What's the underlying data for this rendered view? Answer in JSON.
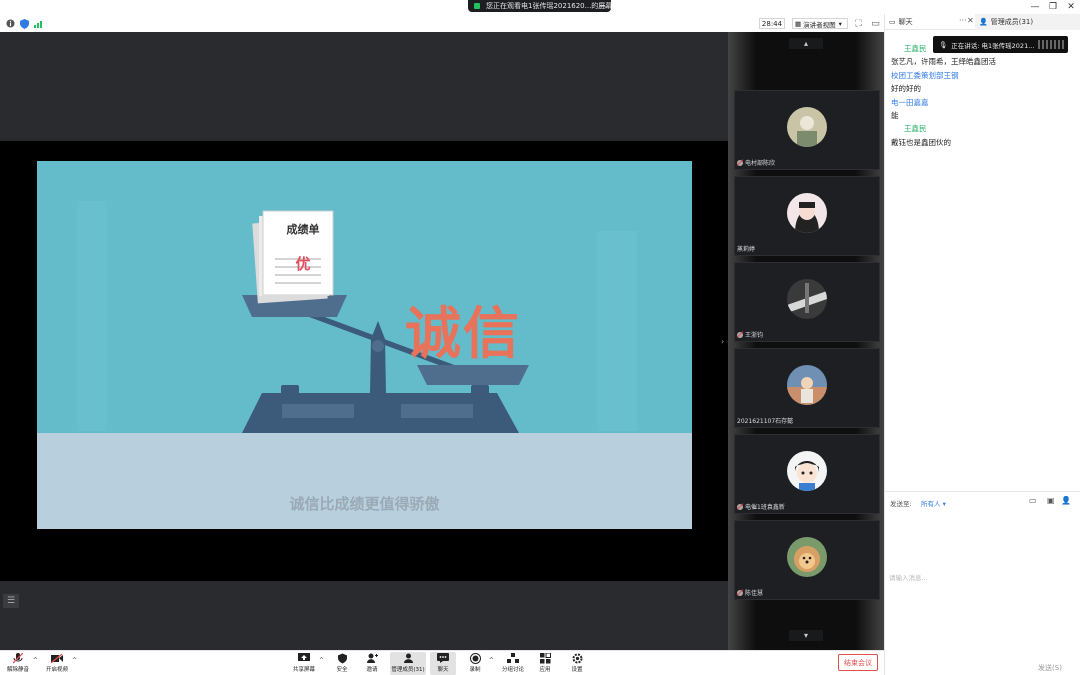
{
  "window": {
    "share_banner": "您正在观看电1张传瑶2021620...的屏幕",
    "time": "28:44",
    "view_mode": "演讲者视图",
    "controls": [
      "—",
      "❐",
      "✕"
    ]
  },
  "slide": {
    "doc_title": "成绩单",
    "doc_grade": "优",
    "big_word": "诚信",
    "caption": "诚信比成绩更值得骄傲"
  },
  "participants": [
    {
      "name": "电村部陈欣",
      "muted": true,
      "avatar_color": "#c9c4a6"
    },
    {
      "name": "蒸莉婷",
      "muted": false,
      "avatar_color": "#f2e6e8"
    },
    {
      "name": "王浙钧",
      "muted": true,
      "avatar_color": "#3a3a3a"
    },
    {
      "name": "2021621107石存懿",
      "muted": false,
      "avatar_color": "#c88f6a"
    },
    {
      "name": "电催1班袁鑫新",
      "muted": true,
      "avatar_color": "#f4f4f4"
    },
    {
      "name": "陈佳慧",
      "muted": true,
      "avatar_color": "#d9a066"
    }
  ],
  "chat": {
    "title": "聊天",
    "members_tab": "管理成员(31)",
    "speaking": "正在讲话: 电1张传瑶2021...",
    "messages": [
      {
        "type": "sender",
        "text": "王鑫民"
      },
      {
        "type": "text",
        "text": "张艺凡，许雨希，王绎皓鑫团活"
      },
      {
        "type": "link",
        "text": "校团工委策划部王钢"
      },
      {
        "type": "text",
        "text": "好的好的"
      },
      {
        "type": "link",
        "text": "电一田嘉嘉"
      },
      {
        "type": "text",
        "text": "能"
      },
      {
        "type": "sender",
        "text": "王鑫民"
      },
      {
        "type": "text",
        "text": "戴钰也是鑫团伙的"
      }
    ],
    "send_to_label": "发送至:",
    "send_to_value": "所有人 ▾",
    "input_placeholder": "请输入消息...",
    "send_label": "发送(S)"
  },
  "toolbar": {
    "unmute": "解除静音",
    "start_video": "开启视频",
    "share_screen": "共享屏幕",
    "security": "安全",
    "invite": "邀请",
    "manage_members": "管理成员(31)",
    "chat": "聊天",
    "record": "录制",
    "breakout": "分组讨论",
    "apps": "应用",
    "settings": "设置",
    "end_meeting": "结束会议"
  }
}
